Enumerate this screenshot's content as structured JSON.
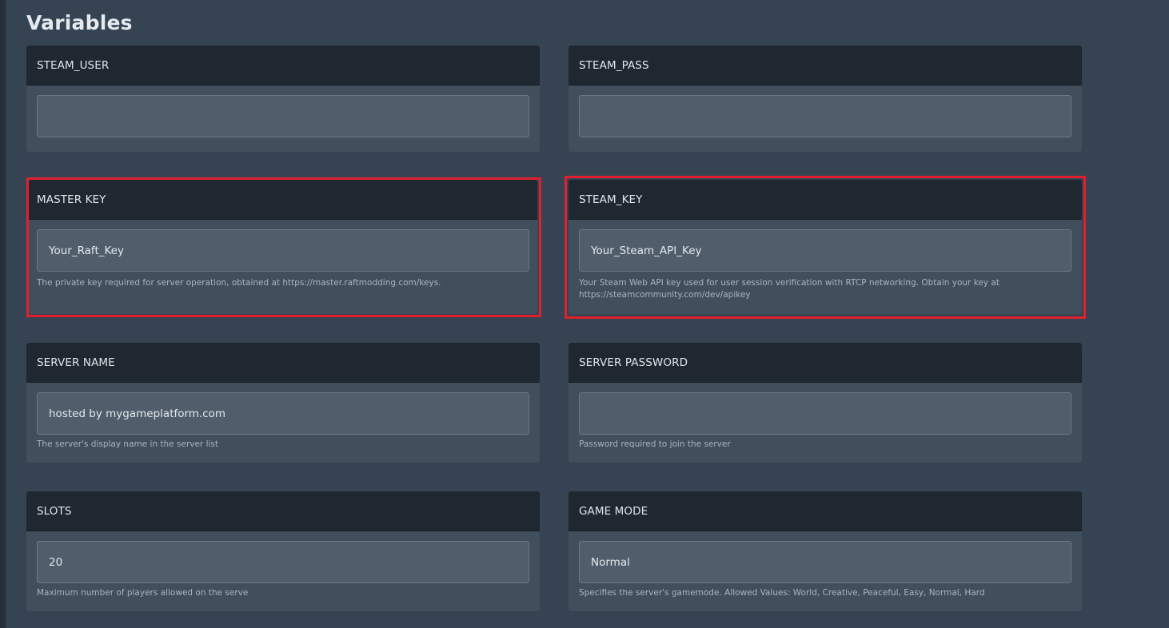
{
  "page": {
    "title": "Variables",
    "highlight_color": "#e0202c"
  },
  "variables": [
    {
      "label": "STEAM_USER",
      "value": "",
      "description": ""
    },
    {
      "label": "STEAM_PASS",
      "value": "",
      "description": ""
    },
    {
      "label": "MASTER KEY",
      "value": "Your_Raft_Key",
      "description": "The private key required for server operation, obtained at https://master.raftmodding.com/keys."
    },
    {
      "label": "STEAM_KEY",
      "value": "Your_Steam_API_Key",
      "description": "Your Steam Web API key used for user session verification with RTCP networking. Obtain your key at https://steamcommunity.com/dev/apikey"
    },
    {
      "label": "SERVER NAME",
      "value": "hosted by mygameplatform.com",
      "description": "The server's display name in the server list"
    },
    {
      "label": "SERVER PASSWORD",
      "value": "",
      "description": "Password required to join the server"
    },
    {
      "label": "SLOTS",
      "value": "20",
      "description": "Maximum number of players allowed on the serve"
    },
    {
      "label": "GAME MODE",
      "value": "Normal",
      "description": "Specifies the server's gamemode. Allowed Values: World, Creative, Peaceful, Easy, Normal, Hard"
    }
  ]
}
